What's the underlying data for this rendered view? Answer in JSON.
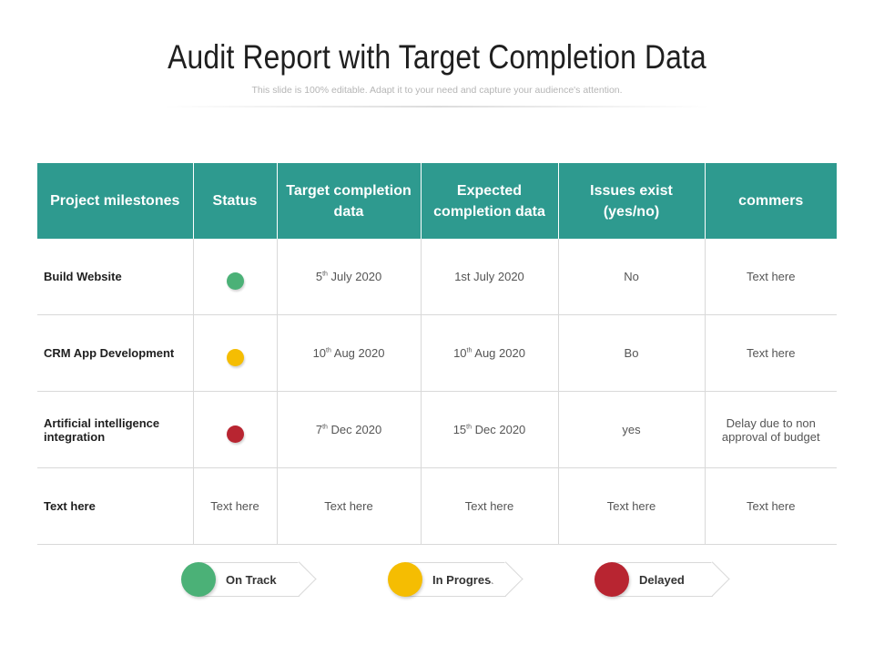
{
  "header": {
    "title": "Audit Report with Target Completion Data",
    "subtitle": "This slide is 100% editable. Adapt it to your need and capture your audience's attention."
  },
  "table": {
    "columns": [
      "Project milestones",
      "Status",
      "Target completion data",
      "Expected completion data",
      "Issues exist (yes/no)",
      "commers"
    ],
    "rows": [
      {
        "milestone": "Build Website",
        "status": "on-track",
        "target_day": "5",
        "target_rest": " July 2020",
        "expected": "1st July 2020",
        "issues": "No",
        "comments": "Text here"
      },
      {
        "milestone": "CRM App Development",
        "status": "in-progress",
        "target_day": "10",
        "target_rest": " Aug 2020",
        "expected_day": "10",
        "expected_rest": " Aug 2020",
        "issues": "Bo",
        "comments": "Text here"
      },
      {
        "milestone": "Artificial intelligence integration",
        "status": "delayed",
        "target_day": "7",
        "target_rest": " Dec 2020",
        "expected_day": "15",
        "expected_rest": " Dec 2020",
        "issues": "yes",
        "comments": "Delay due to non approval of budget"
      },
      {
        "milestone": "Text here",
        "status_text": "Text here",
        "target": "Text here",
        "expected": "Text here",
        "issues": "Text here",
        "comments": "Text here"
      }
    ],
    "ordinal_suffix": "th"
  },
  "legend": [
    {
      "label": "On Track",
      "color": "#4bb177"
    },
    {
      "label": "In Progress",
      "color": "#f5bd02"
    },
    {
      "label": "Delayed",
      "color": "#b82531"
    }
  ],
  "colors": {
    "header_bg": "#2e9a8f",
    "on_track": "#4bb177",
    "in_progress": "#f5bd02",
    "delayed": "#b82531"
  }
}
